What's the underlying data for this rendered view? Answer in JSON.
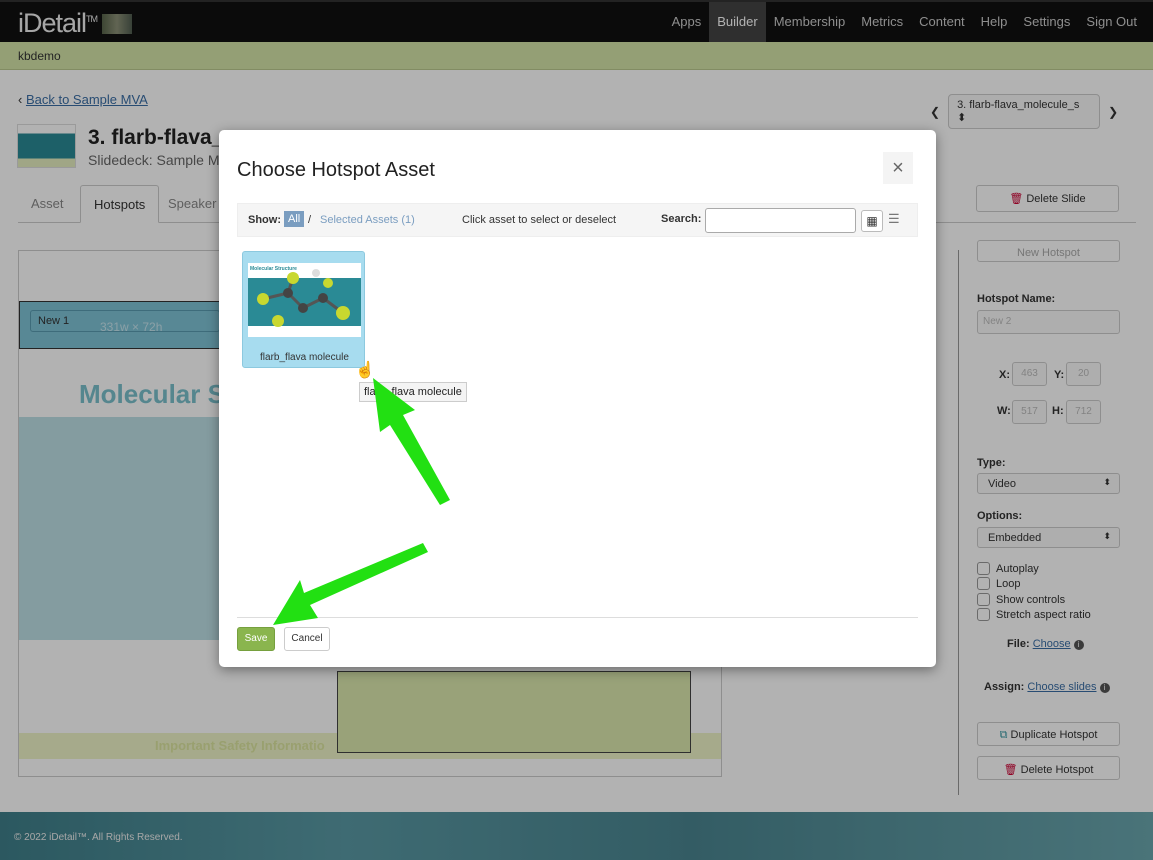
{
  "nav": {
    "logo": "iDetail",
    "logo_tm": "TM",
    "items": [
      "Apps",
      "Builder",
      "Membership",
      "Metrics",
      "Content",
      "Help",
      "Settings",
      "Sign Out"
    ],
    "active": "Builder"
  },
  "account": "kbdemo",
  "back_link": "Back to Sample MVA",
  "slide_selector": "3. flarb-flava_molecule_s",
  "slide": {
    "title": "3. flarb-flava_",
    "subtitle": "Slidedeck: Sample MV"
  },
  "tabs": [
    "Asset",
    "Hotspots",
    "Speaker"
  ],
  "delete_slide": "Delete Slide",
  "canvas": {
    "hotspot_label": "New 1",
    "hotspot_dims": "331w × 72h",
    "heading": "Molecular S",
    "isi": "Important Safety Informatio"
  },
  "sidebar": {
    "new_hotspot": "New Hotspot",
    "name_label": "Hotspot Name:",
    "name_placeholder": "New 2",
    "x_label": "X:",
    "x": "463",
    "y_label": "Y:",
    "y": "20",
    "w_label": "W:",
    "w": "517",
    "h_label": "H:",
    "h": "712",
    "type_label": "Type:",
    "type": "Video",
    "options_label": "Options:",
    "options": "Embedded",
    "checkboxes": [
      "Autoplay",
      "Loop",
      "Show controls",
      "Stretch aspect ratio"
    ],
    "file_label": "File:",
    "file_link": "Choose",
    "assign_label": "Assign:",
    "assign_link": "Choose slides",
    "duplicate": "Duplicate Hotspot",
    "delete": "Delete Hotspot"
  },
  "footer": "© 2022 iDetail™.  All Rights Reserved.",
  "modal": {
    "title": "Choose Hotspot Asset",
    "close": "×",
    "show_label": "Show:",
    "all": "All",
    "slash": "/",
    "selected_assets": "Selected Assets (1)",
    "hint": "Click asset to select or deselect",
    "search_label": "Search:",
    "search_value": "",
    "asset": {
      "name": "flarb_flava molecule",
      "thumb_title": "Molecular Structure"
    },
    "tooltip": "flarb_flava molecule",
    "save": "Save",
    "cancel": "Cancel"
  },
  "colors": {
    "accent_green": "#8ab54e",
    "annotation_arrow": "#22e012",
    "link": "#3a6ea5"
  }
}
